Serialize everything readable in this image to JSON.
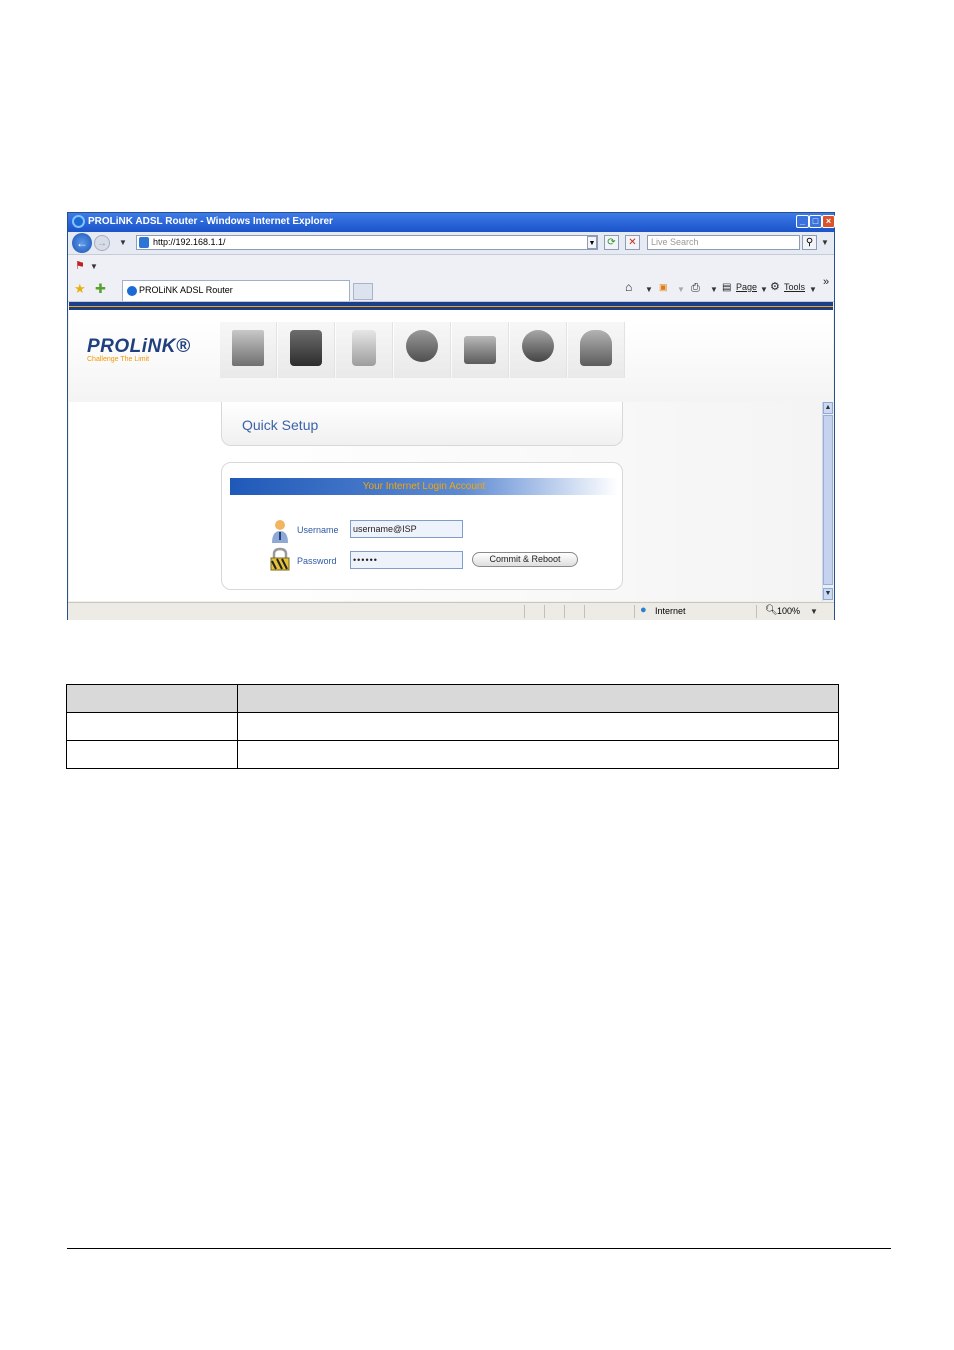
{
  "browser": {
    "window_title": "PROLiNK ADSL Router - Windows Internet Explorer",
    "address": "http://192.168.1.1/",
    "search_placeholder": "Live Search",
    "tab_title": "PROLiNK ADSL Router",
    "page_menu": "Page",
    "tools_menu": "Tools",
    "overflow": "»",
    "status_zone": "Internet",
    "zoom": "100%"
  },
  "router": {
    "brand": "PROLiNK®",
    "tagline": "Challenge The Limit",
    "nav_icons": [
      "status-icon",
      "setup-icon",
      "device-icon",
      "wan-icon",
      "security-icon",
      "network-icon",
      "user-icon"
    ],
    "quick_setup_title": "Quick Setup",
    "login_header": "Your Internet Login Account",
    "username_label": "Username",
    "username_value": "username@ISP",
    "password_label": "Password",
    "password_value": "••••••",
    "commit_button": "Commit & Reboot"
  },
  "colors": {
    "title_bar": "#1b53c9",
    "router_brand_blue": "#1f3f7d",
    "accent_orange": "#f6a700",
    "label_blue": "#2f5aa4"
  },
  "doc_table": {
    "rows": [
      [
        "",
        ""
      ],
      [
        "",
        ""
      ],
      [
        "",
        ""
      ]
    ]
  }
}
